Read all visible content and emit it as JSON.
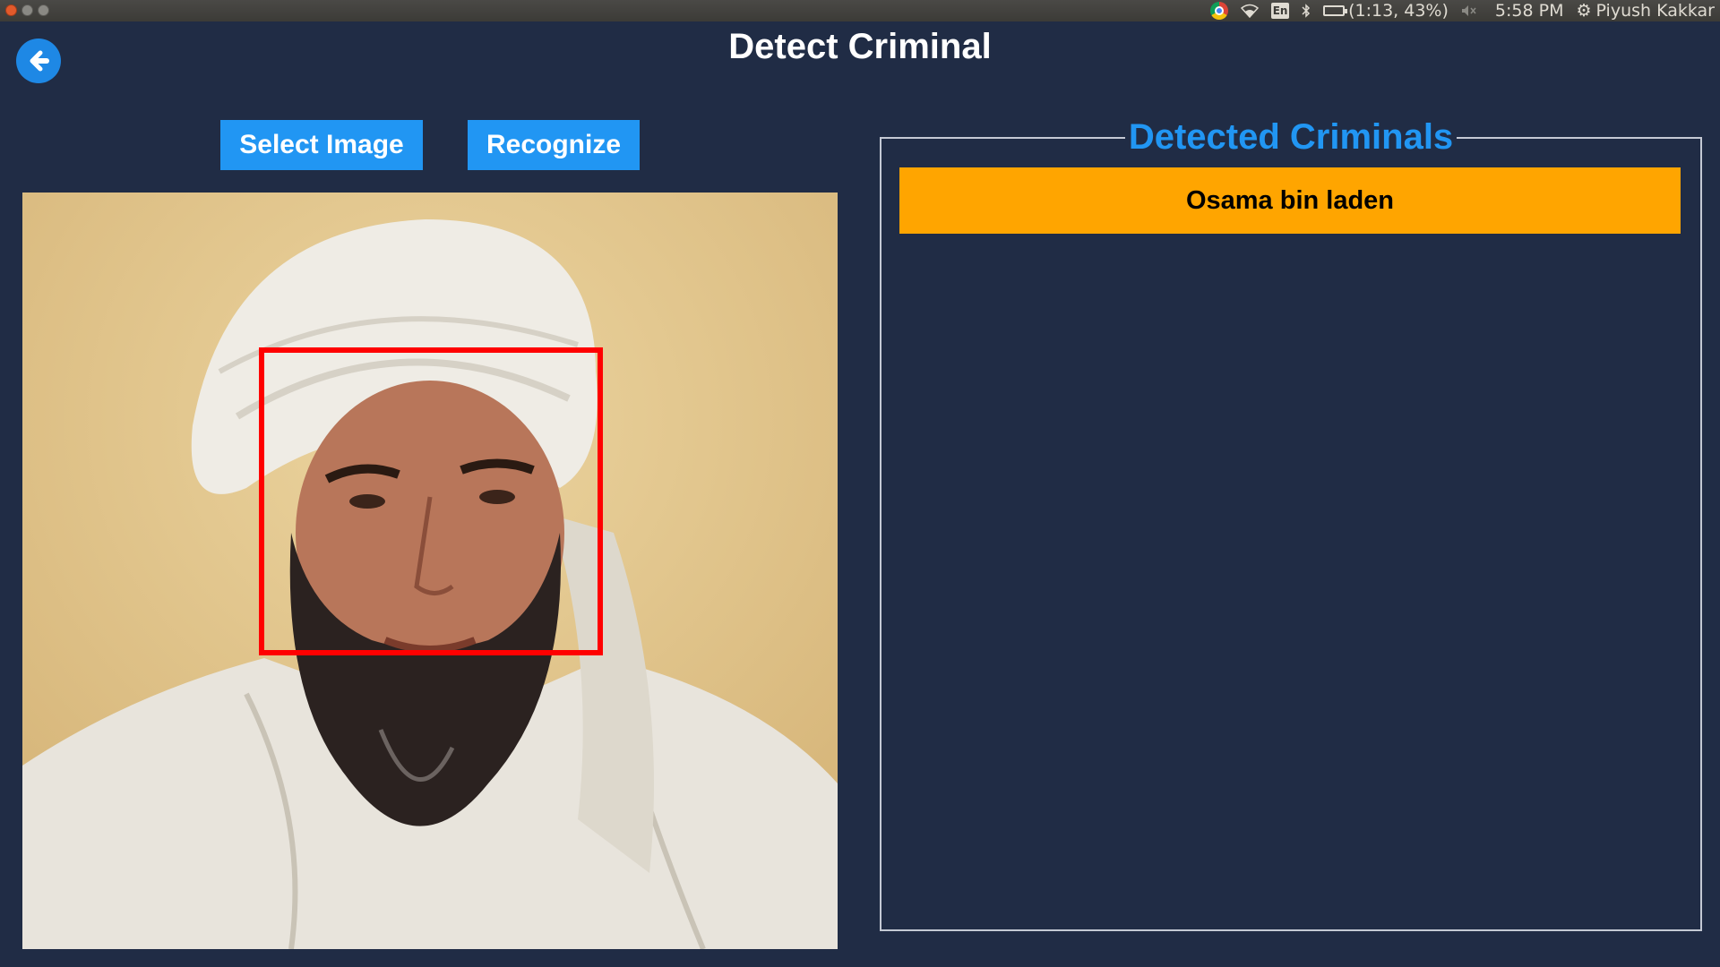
{
  "system_bar": {
    "battery": "(1:13, 43%)",
    "time": "5:58 PM",
    "user": "Piyush Kakkar",
    "keyboard_layout": "En",
    "icons": [
      "chrome-icon",
      "wifi-icon",
      "keyboard-layout-icon",
      "bluetooth-icon",
      "battery-icon",
      "volume-muted-icon",
      "gear-icon"
    ]
  },
  "header": {
    "title": "Detect Criminal",
    "back_icon": "arrow-left-icon"
  },
  "toolbar": {
    "select_label": "Select Image",
    "recognize_label": "Recognize"
  },
  "detected_panel": {
    "title": "Detected Criminals",
    "results": [
      {
        "name": "Osama bin laden"
      }
    ]
  },
  "colors": {
    "background": "#202c45",
    "accent": "#2196f3",
    "result_highlight": "#ffa500",
    "face_box": "#ff0000"
  }
}
